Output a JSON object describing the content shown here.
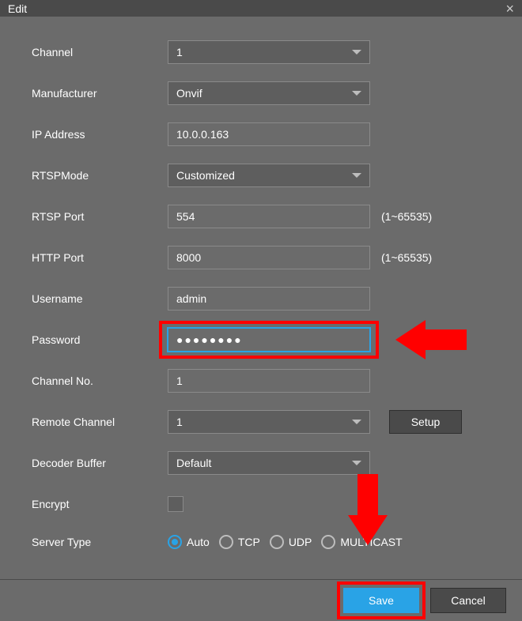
{
  "dialog": {
    "title": "Edit"
  },
  "fields": {
    "channel": {
      "label": "Channel",
      "value": "1"
    },
    "manufacturer": {
      "label": "Manufacturer",
      "value": "Onvif"
    },
    "ip_address": {
      "label": "IP Address",
      "value": "10.0.0.163"
    },
    "rtsp_mode": {
      "label": "RTSPMode",
      "value": "Customized"
    },
    "rtsp_port": {
      "label": "RTSP Port",
      "value": "554",
      "hint": "(1~65535)"
    },
    "http_port": {
      "label": "HTTP Port",
      "value": "8000",
      "hint": "(1~65535)"
    },
    "username": {
      "label": "Username",
      "value": "admin"
    },
    "password": {
      "label": "Password",
      "value": "●●●●●●●●"
    },
    "channel_no": {
      "label": "Channel No.",
      "value": "1"
    },
    "remote_channel": {
      "label": "Remote Channel",
      "value": "1",
      "setup": "Setup"
    },
    "decoder_buffer": {
      "label": "Decoder Buffer",
      "value": "Default"
    },
    "encrypt": {
      "label": "Encrypt",
      "checked": false
    },
    "server_type": {
      "label": "Server Type",
      "selected": "Auto",
      "options": {
        "auto": "Auto",
        "tcp": "TCP",
        "udp": "UDP",
        "multicast": "MULTICAST"
      }
    }
  },
  "buttons": {
    "save": "Save",
    "cancel": "Cancel"
  }
}
